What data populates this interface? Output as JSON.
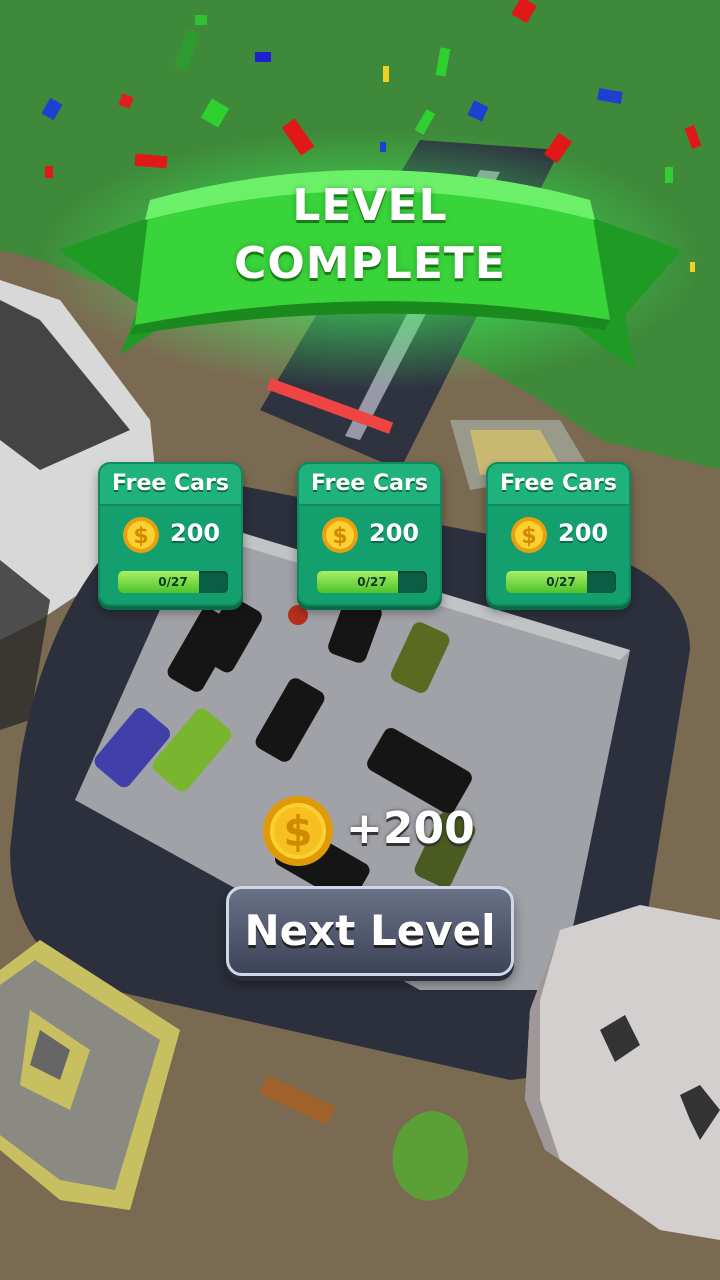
{
  "banner": {
    "line1": "LEVEL",
    "line2": "COMPLETE"
  },
  "cards": [
    {
      "title": "Free Cars",
      "amount": "200",
      "progress_label": "0/27",
      "progress_fraction": 0.74
    },
    {
      "title": "Free Cars",
      "amount": "200",
      "progress_label": "0/27",
      "progress_fraction": 0.74
    },
    {
      "title": "Free Cars",
      "amount": "200",
      "progress_label": "0/27",
      "progress_fraction": 0.74
    }
  ],
  "reward": {
    "amount": "+200"
  },
  "next_button": {
    "label": "Next Level"
  },
  "colors": {
    "banner_green": "#2ecc2e",
    "card_green": "#13a06e",
    "progress_green": "#6bd83a",
    "button_slate": "#4e5468"
  },
  "icons": {
    "coin": "dollar-coin-icon"
  }
}
